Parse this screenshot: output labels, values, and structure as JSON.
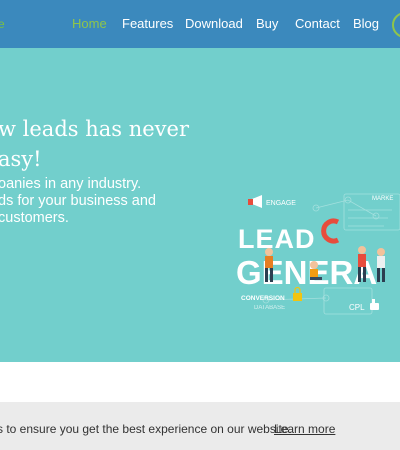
{
  "nav": {
    "logo_fragment": "e",
    "items": [
      {
        "label": "Home",
        "active": true
      },
      {
        "label": "Features",
        "active": false
      },
      {
        "label": "Download",
        "active": false
      },
      {
        "label": "Buy",
        "active": false
      },
      {
        "label": "Contact",
        "active": false
      },
      {
        "label": "Blog",
        "active": false
      }
    ]
  },
  "hero": {
    "headline_line1": "w leads has never",
    "headline_line2": "asy!",
    "sub_line1": "oanies in any industry.",
    "sub_line2": "ds for your business and",
    "sub_line3": "customers."
  },
  "illustration": {
    "engage": "ENGAGE",
    "market": "MARKE",
    "lead": "LEAD",
    "genera": "GENERA",
    "conversion": "CONVERSION",
    "database": "DATABASE",
    "cpl": "CPL"
  },
  "cookie": {
    "text": "s to ensure you get the best experience on our website.",
    "learn_more": "Learn more"
  },
  "colors": {
    "nav_bg": "#3b89bd",
    "active": "#8fc54a",
    "hero_bg": "#72cfcc",
    "cookie_bg": "#ebebeb"
  }
}
